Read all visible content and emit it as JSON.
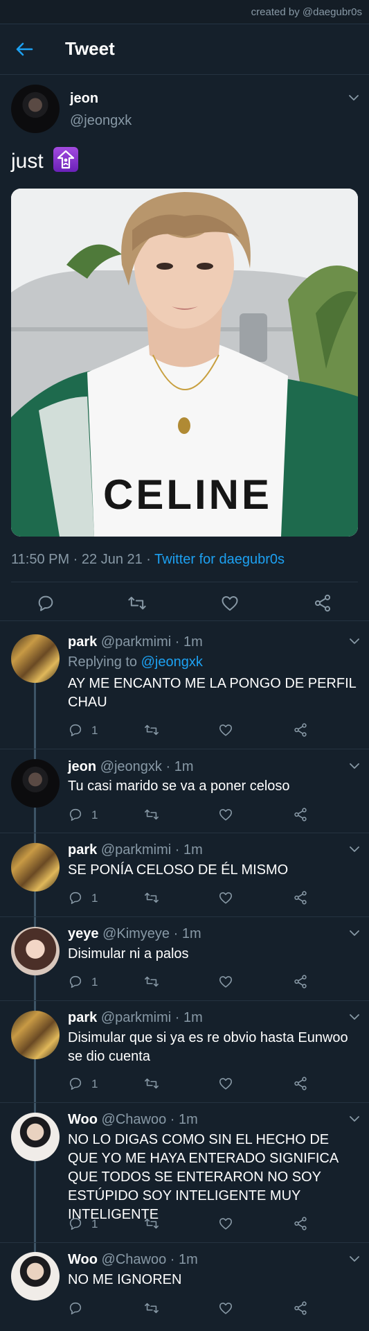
{
  "credit": "created by @daegubr0s",
  "header": {
    "title": "Tweet"
  },
  "tweet": {
    "name": "jeon",
    "handle": "@jeongxk",
    "text": "just",
    "time_date": "11:50 PM · 22 Jun 21 · ",
    "source": "Twitter for daegubr0s",
    "photo_text": "CELINE"
  },
  "replies": [
    {
      "name": "park",
      "handle": "@parkmimi · 1m",
      "replying_label": "Replying to ",
      "replying_handle": "@jeongxk",
      "text": "AY ME ENCANTO ME LA PONGO DE PERFIL CHAU",
      "reply_count": "1"
    },
    {
      "name": "jeon",
      "handle": "@jeongxk · 1m",
      "text": "Tu casi marido se va a poner celoso",
      "reply_count": "1"
    },
    {
      "name": "park",
      "handle": "@parkmimi · 1m",
      "text": "SE PONÍA CELOSO DE ÉL MISMO",
      "reply_count": "1"
    },
    {
      "name": "yeye",
      "handle": "@Kimyeye · 1m",
      "text": "Disimular ni a palos",
      "reply_count": "1"
    },
    {
      "name": "park",
      "handle": "@parkmimi · 1m",
      "text": "Disimular que si ya es re obvio hasta Eunwoo se dio cuenta",
      "reply_count": "1"
    },
    {
      "name": "Woo",
      "handle": "@Chawoo · 1m",
      "text": "NO LO DIGAS COMO SIN EL HECHO DE QUE YO ME HAYA ENTERADO SIGNIFICA QUE TODOS SE ENTERARON NO SOY ESTÚPIDO SOY INTELIGENTE MUY INTELIGENTE",
      "reply_count": "1"
    },
    {
      "name": "Woo",
      "handle": "@Chawoo · 1m",
      "text": "NO ME IGNOREN"
    }
  ],
  "colors": {
    "background": "#15202b",
    "accent": "#1da1f2",
    "secondary_text": "#8899a6"
  }
}
